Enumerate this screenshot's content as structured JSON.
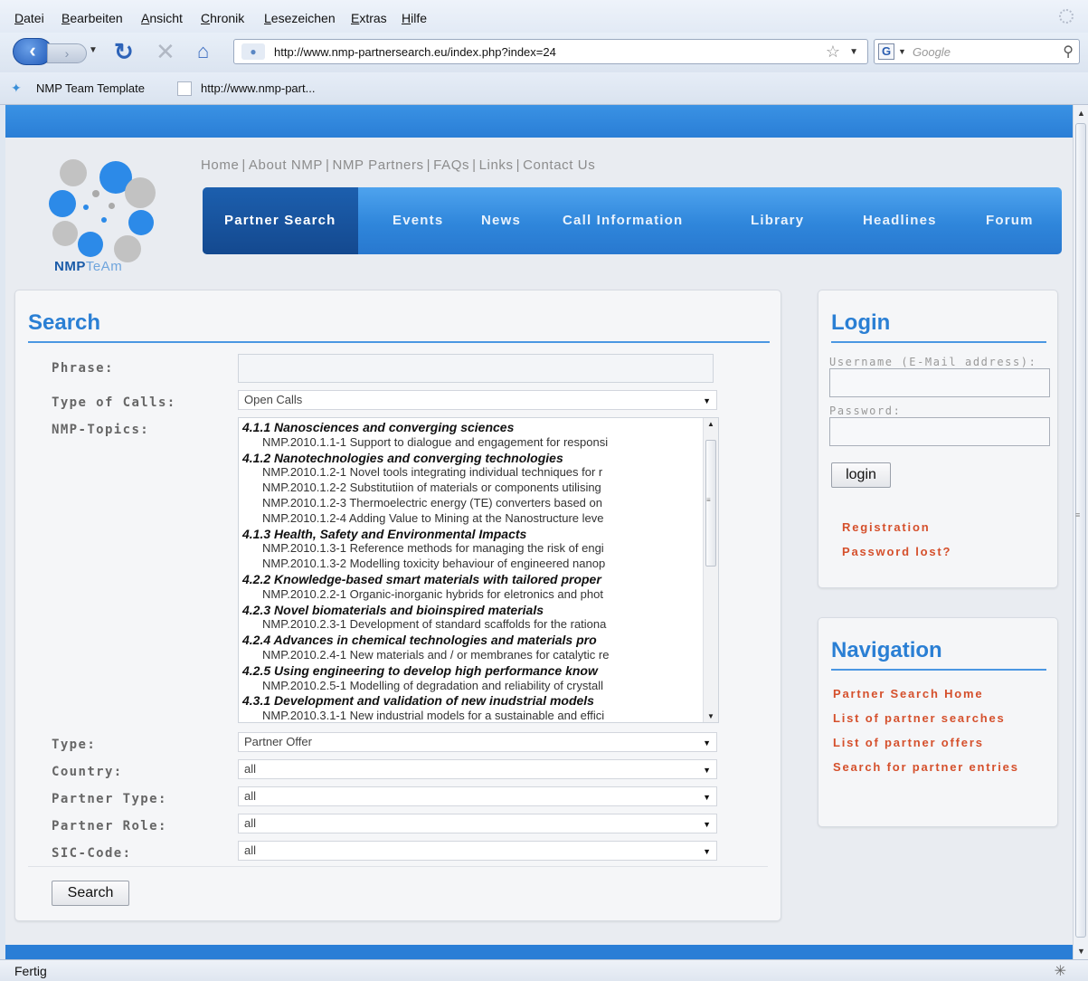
{
  "browser": {
    "menu": [
      "Datei",
      "Bearbeiten",
      "Ansicht",
      "Chronik",
      "Lesezeichen",
      "Extras",
      "Hilfe"
    ],
    "url": "http://www.nmp-partnersearch.eu/index.php?index=24",
    "search_placeholder": "Google",
    "bookmarks": [
      "NMP Team Template",
      "http://www.nmp-part..."
    ],
    "status": "Fertig"
  },
  "site": {
    "logo_primary": "NMP",
    "logo_secondary": "TeAm",
    "toplinks": [
      "Home",
      "About NMP",
      "NMP Partners",
      "FAQs",
      "Links",
      "Contact Us"
    ],
    "nav": [
      "Partner Search",
      "Events",
      "News",
      "Call Information",
      "Library",
      "Headlines",
      "Forum"
    ]
  },
  "search": {
    "title": "Search",
    "phrase_label": "Phrase:",
    "phrase_value": "",
    "calls_label": "Type of Calls:",
    "calls_value": "Open Calls",
    "topics_label": "NMP-Topics:",
    "topics": [
      {
        "kind": "group",
        "text": "4.1.1 Nanosciences and converging sciences"
      },
      {
        "kind": "item",
        "text": "NMP.2010.1.1-1 Support to dialogue and engagement for responsi"
      },
      {
        "kind": "group",
        "text": "4.1.2 Nanotechnologies and converging technologies"
      },
      {
        "kind": "item",
        "text": "NMP.2010.1.2-1 Novel tools integrating individual techniques for r"
      },
      {
        "kind": "item",
        "text": "NMP.2010.1.2-2 Substitutiion of materials or components utilising"
      },
      {
        "kind": "item",
        "text": "NMP.2010.1.2-3 Thermoelectric energy (TE) converters based on"
      },
      {
        "kind": "item",
        "text": "NMP.2010.1.2-4 Adding Value to Mining at the Nanostructure leve"
      },
      {
        "kind": "group",
        "text": "4.1.3 Health, Safety and Environmental Impacts"
      },
      {
        "kind": "item",
        "text": "NMP.2010.1.3-1 Reference methods for managing the risk of engi"
      },
      {
        "kind": "item",
        "text": "NMP.2010.1.3-2 Modelling toxicity behaviour of engineered nanop"
      },
      {
        "kind": "group",
        "text": "4.2.2 Knowledge-based smart materials with tailored proper"
      },
      {
        "kind": "item",
        "text": "NMP.2010.2.2-1 Organic-inorganic hybrids for eletronics and phot"
      },
      {
        "kind": "group",
        "text": "4.2.3 Novel biomaterials and bioinspired materials"
      },
      {
        "kind": "item",
        "text": "NMP.2010.2.3-1 Development of standard scaffolds for the rationa"
      },
      {
        "kind": "group",
        "text": "4.2.4 Advances in chemical technologies and materials pro"
      },
      {
        "kind": "item",
        "text": "NMP.2010.2.4-1 New materials and / or membranes for catalytic re"
      },
      {
        "kind": "group",
        "text": "4.2.5 Using engineering to develop high performance know"
      },
      {
        "kind": "item",
        "text": "NMP.2010.2.5-1 Modelling of degradation and reliability of crystall"
      },
      {
        "kind": "group",
        "text": "4.3.1 Development and validation of new inudstrial models"
      },
      {
        "kind": "item",
        "text": "NMP.2010.3.1-1 New industrial models for a sustainable and effici"
      }
    ],
    "type_label": "Type:",
    "type_value": "Partner Offer",
    "country_label": "Country:",
    "country_value": "all",
    "ptype_label": "Partner Type:",
    "ptype_value": "all",
    "prole_label": "Partner Role:",
    "prole_value": "all",
    "sic_label": "SIC-Code:",
    "sic_value": "all",
    "button": "Search"
  },
  "login": {
    "title": "Login",
    "username_label": "Username (E-Mail address):",
    "password_label": "Password:",
    "button": "login",
    "registration": "Registration",
    "lost": "Password lost?"
  },
  "navigation": {
    "title": "Navigation",
    "links": [
      "Partner Search Home",
      "List of partner searches",
      "List of partner offers",
      "Search for partner entries"
    ]
  },
  "colors": {
    "brand_blue": "#2a7ed6",
    "nav_active": "#14498f",
    "link_red": "#d5502c"
  }
}
